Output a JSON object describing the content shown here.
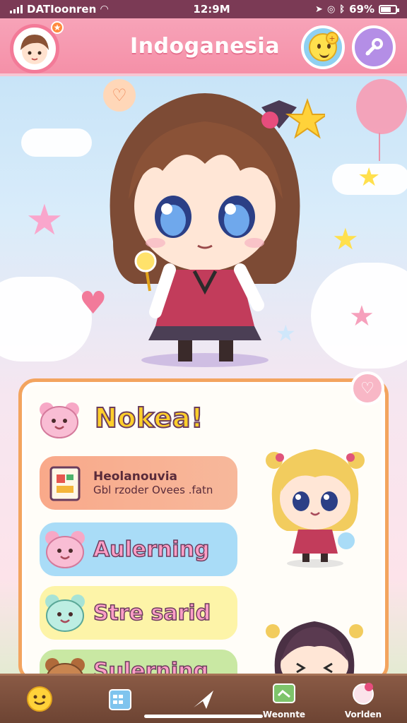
{
  "status_bar": {
    "carrier": "DATIoonren",
    "time": "12:9M",
    "battery": "69%"
  },
  "header": {
    "title": "Indoganesia",
    "avatar_badge": "★"
  },
  "card": {
    "title": "Nokea!",
    "items": [
      {
        "line1": "Heolanouvia",
        "line2": "Gbl rzoder Ovees .fatn"
      },
      {
        "label": "Aulerning"
      },
      {
        "label": "Stre sarid"
      },
      {
        "label": "Sulerning"
      }
    ]
  },
  "nav": {
    "items": [
      {
        "label": ""
      },
      {
        "label": ""
      },
      {
        "label": ""
      },
      {
        "label": "Weonnte"
      },
      {
        "label": "Vorlden"
      }
    ]
  },
  "colors": {
    "header": "#f590a8",
    "card_border": "#f3a45f",
    "title_yellow": "#ffcf2b",
    "nav": "#7a4c3b"
  }
}
